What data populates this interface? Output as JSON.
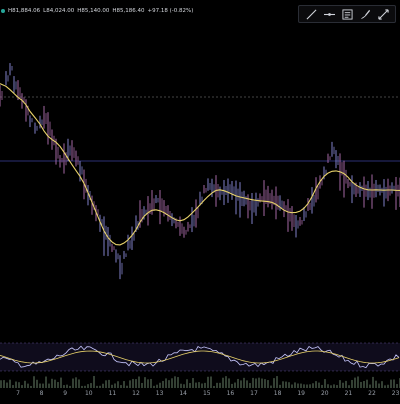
{
  "ohlc": {
    "symbol_marker": "●",
    "values": [
      "H81,884.06",
      "L84,024.00",
      "H85,140.00",
      "H85,186.40",
      "+97.18 (-0.82%)"
    ]
  },
  "toolbar": {
    "icons": [
      "trend-line-icon",
      "horizontal-line-icon",
      "text-icon",
      "brush-icon",
      "measure-icon"
    ]
  },
  "x_axis": {
    "labels": [
      "7",
      "8",
      "9",
      "10",
      "11",
      "12",
      "13",
      "14",
      "15",
      "16",
      "17",
      "18",
      "19",
      "20",
      "21",
      "22",
      "23"
    ]
  },
  "colors": {
    "background": "#000000",
    "candles": "#8a8ad8",
    "candles_alt": "#b06fb0",
    "moving_average": "#e8d26a",
    "reference_line_blue": "#3a3f9a",
    "reference_line_dashed": "#8a8a8a",
    "oscillator_band": "#2a2150",
    "volume": "#4a5b4a"
  }
}
